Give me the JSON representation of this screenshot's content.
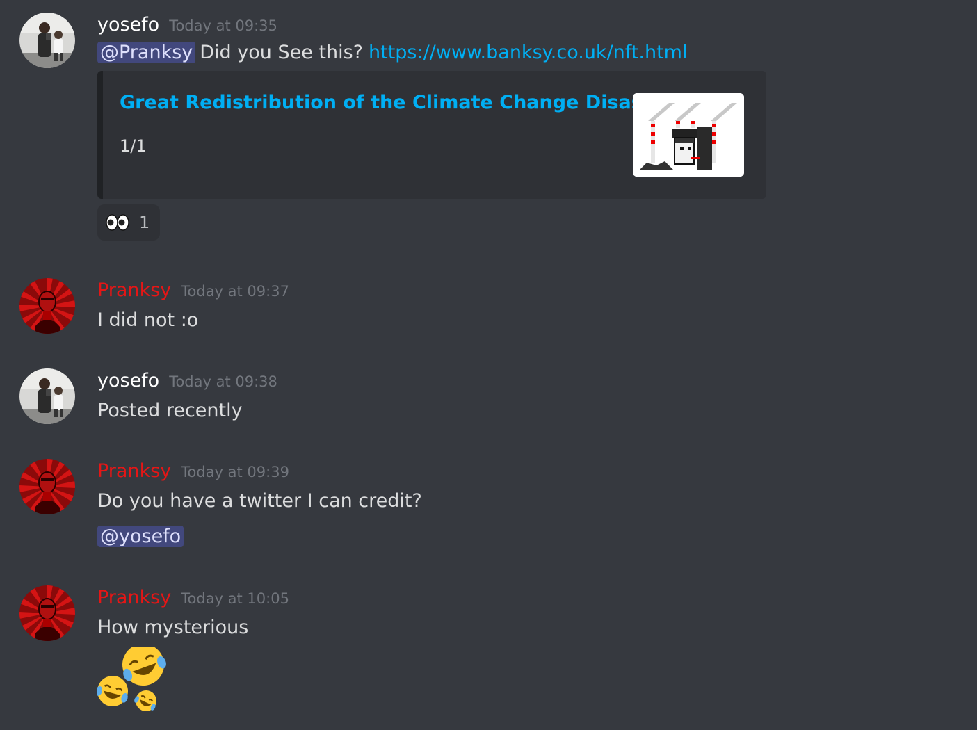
{
  "messages": [
    {
      "author": "yosefo",
      "timestamp": "Today at 09:35",
      "mention": "@Pranksy",
      "text": "Did you See this?",
      "link": "https://www.banksy.co.uk/nft.html",
      "embed": {
        "title": "Great Redistribution of the Climate Change Disaster",
        "description": "1/1"
      },
      "reaction": {
        "icon": "eyes-emoji",
        "count": "1"
      }
    },
    {
      "author": "Pranksy",
      "timestamp": "Today at 09:37",
      "text": "I did not :o"
    },
    {
      "author": "yosefo",
      "timestamp": "Today at 09:38",
      "text": "Posted recently"
    },
    {
      "author": "Pranksy",
      "timestamp": "Today at 09:39",
      "text": "Do you have a twitter I can credit?",
      "mention": "@yosefo"
    },
    {
      "author": "Pranksy",
      "timestamp": "Today at 10:05",
      "text": "How mysterious",
      "emoji": "joy-emoji-cluster"
    }
  ],
  "colors": {
    "background": "#36393f",
    "pranksy": "#e51616",
    "link": "#00aff4",
    "timestamp": "#72767d"
  }
}
